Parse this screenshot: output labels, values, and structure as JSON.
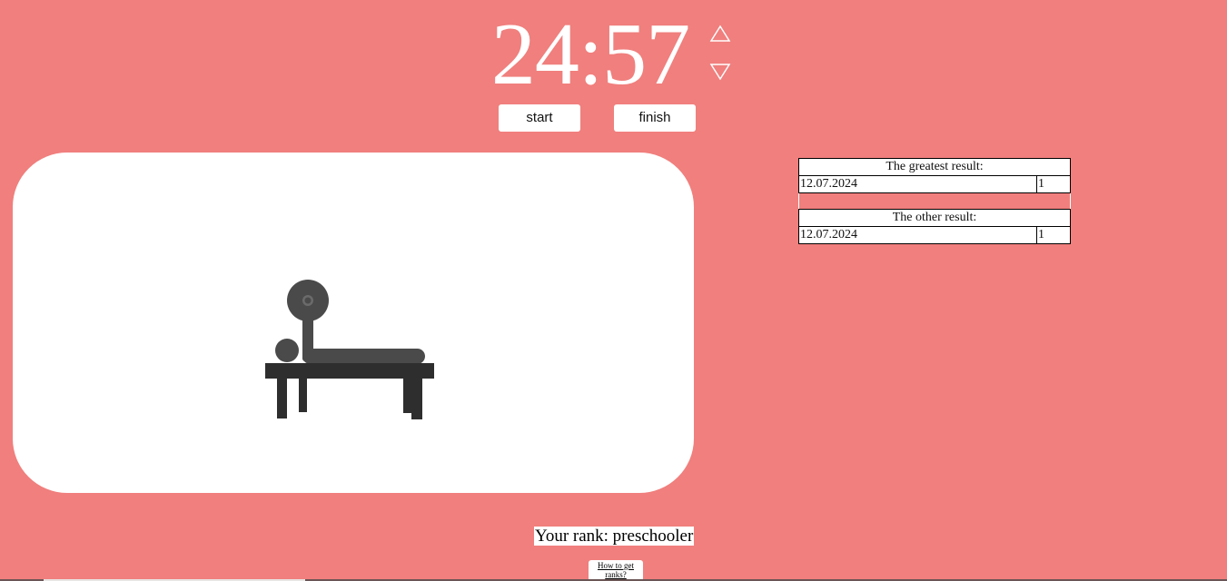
{
  "timer": {
    "display": "24:57"
  },
  "controls": {
    "start_label": "start",
    "finish_label": "finish",
    "increase_icon": "triangle-up-outline-icon",
    "decrease_icon": "triangle-down-outline-icon"
  },
  "illustration": {
    "icon": "bench-press-icon"
  },
  "results": {
    "greatest": {
      "heading": "The greatest result:",
      "rows": [
        {
          "date": "12.07.2024",
          "count": "1"
        }
      ]
    },
    "other": {
      "heading": "The other result:",
      "rows": [
        {
          "date": "12.07.2024",
          "count": "1"
        }
      ]
    }
  },
  "rank": {
    "text": "Your rank: preschooler"
  },
  "help": {
    "link_label": "How to get ranks?"
  },
  "colors": {
    "background": "#f07f7d",
    "panel": "#ffffff",
    "figure_dark": "#2e2e2e",
    "figure_mid": "#4a4a4a"
  }
}
